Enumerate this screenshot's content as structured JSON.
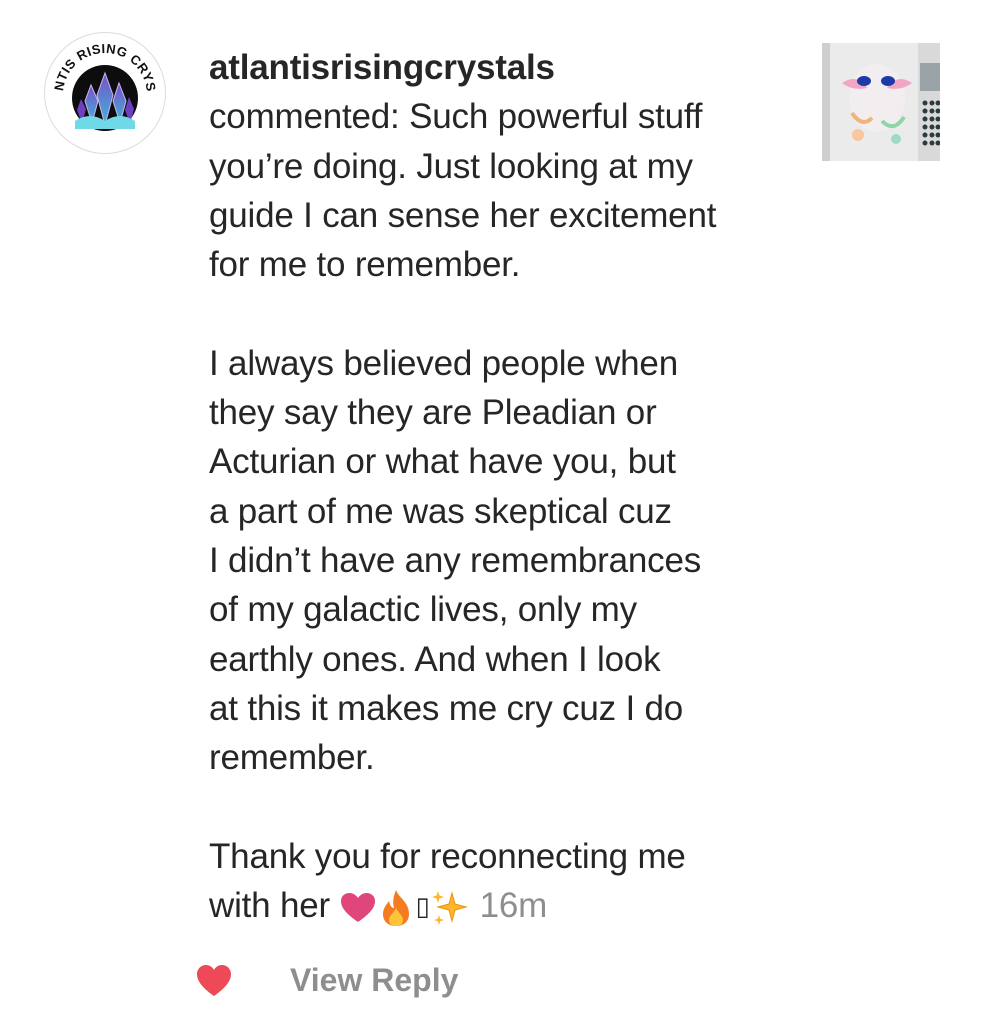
{
  "notification": {
    "username": "atlantisrisingcrystals",
    "avatar": {
      "icon": "crystal-logo-icon",
      "logo_text": "ATLANTIS RISING CRYSTALS"
    },
    "comment": {
      "para1": "commented: Such powerful stuff\nyou’re doing. Just looking at my\nguide I can sense her excitement\nfor me to remember.",
      "para2": "I always believed people when\nthey say they are Pleadian or\nActurian or what have you, but\na part of me was skeptical cuz\nI didn’t have any remembrances\nof my galactic lives, only my\nearthly ones. And when I look\nat this it makes me cry cuz I do\nremember.",
      "para3_line1": "Thank you for reconnecting me",
      "para3_line2": "with her",
      "emojis": [
        "heart-icon",
        "fire-icon",
        "missing-glyph-icon",
        "sparkles-icon"
      ],
      "missing_glyph": "▯"
    },
    "timestamp": "16m",
    "post_thumbnail": {
      "icon": "alien-painting-thumbnail"
    },
    "actions": {
      "like_icon": "heart-icon",
      "like_color": "#ed4956",
      "view_reply_label": "View Reply"
    }
  }
}
